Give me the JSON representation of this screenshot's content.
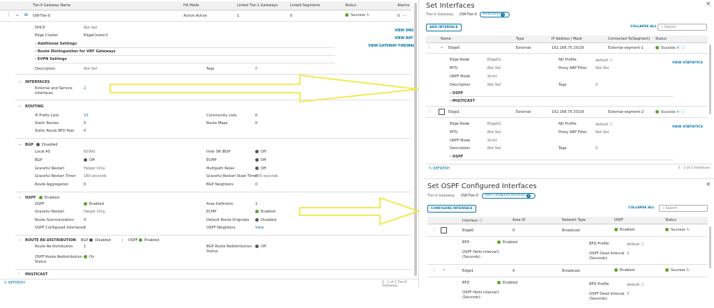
{
  "left": {
    "columns": [
      "Tier-0 Gateway Name",
      "HA Mode",
      "Linked Tier-1 Gateways",
      "Linked Segments",
      "Status",
      "Alarms"
    ],
    "row": {
      "name": "OW-Tier-0",
      "ha_mode": "Active Active",
      "tier1": "1",
      "segments": "0",
      "status": "Success",
      "alarms": "0"
    },
    "dhcp_label": "DHCP",
    "dhcp_value": "Not Set",
    "edge_cluster_label": "Edge Cluster",
    "edge_cluster_value": "EdgeCluster1",
    "additional_settings": "Additional Settings",
    "route_distinguisher": "Route Distinguisher for VRF Gateways",
    "evpn_settings": "EVPN Settings",
    "description_label": "Description",
    "description_value": "Not Set",
    "tags_label": "Tags",
    "tags_value": "0",
    "view_dns": "VIEW DNS",
    "view_nat": "VIEW NAT",
    "view_fw": "VIEW GATEWAY FIREWALL",
    "interfaces_title": "INTERFACES",
    "ext_service_label_1": "External and Service",
    "ext_service_label_2": "Interfaces",
    "ext_service_value": "2",
    "routing_title": "ROUTING",
    "ip_prefix_label": "IP Prefix Lists",
    "ip_prefix_value": "10",
    "community_label": "Community Lists",
    "community_value": "0",
    "static_routes_label": "Static Routes",
    "static_routes_value": "0",
    "route_maps_label": "Route Maps",
    "route_maps_value": "0",
    "static_bfd_label": "Static Route BFD Peer",
    "static_bfd_value": "0",
    "bgp_title": "BGP",
    "bgp_state": "Disabled",
    "local_as_label": "Local AS",
    "local_as_value": "65000",
    "inter_sr_label": "Inter SR iBGP",
    "inter_sr_value": "Off",
    "bgp_label": "BGP",
    "bgp_value": "Off",
    "ecmp_label": "ECMP",
    "ecmp_value": "Off",
    "gr_label": "Graceful Restart",
    "gr_value": "Helper Only",
    "multipath_label": "Multipath Relax",
    "multipath_value": "Off",
    "gr_timer_label": "Graceful Restart Timer",
    "gr_timer_value": "180 seconds",
    "gr_stale_label": "Graceful Restart Stale Timer",
    "gr_stale_value": "600 seconds",
    "route_agg_label": "Route Aggregation",
    "route_agg_value": "0",
    "bgp_neighbors_label": "BGP Neighbors",
    "bgp_neighbors_value": "0",
    "ospf_title": "OSPF",
    "ospf_state": "Enabled",
    "ospf_label": "OSPF",
    "ospf_value": "Enabled",
    "area_def_label": "Area Definition",
    "area_def_value": "1",
    "ospf_gr_label": "Graceful Restart",
    "ospf_gr_value": "Helper Only",
    "ospf_ecmp_label": "ECMP",
    "ospf_ecmp_value": "Enabled",
    "route_summ_label": "Route Summarization",
    "route_summ_value": "0",
    "default_route_label": "Default Route Originate",
    "default_route_value": "Disabled",
    "ospf_ci_label": "OSPF Configured Interfaces",
    "ospf_ci_value": "2",
    "ospf_neighbors_label": "OSPF Neighbors",
    "ospf_neighbors_value": "View",
    "redist_title": "ROUTE RE-DISTRIBUTION",
    "redist_bgp": "BGP",
    "redist_bgp_state": "Disabled",
    "redist_ospf": "OSPF",
    "redist_ospf_state": "Enabled",
    "route_redist_label": "Route Re-distribution",
    "route_redist_value": "1",
    "bgp_redist_status_label_1": "BGP Route Redistribution",
    "bgp_redist_status_label_2": "Status",
    "bgp_redist_status_value": "Off",
    "ospf_redist_status_label_1": "OSPF Route Redistribution",
    "ospf_redist_status_label_2": "Status",
    "ospf_redist_status_value": "On",
    "multicast_title": "MULTICAST",
    "refresh": "REFRESH",
    "footer": "1 - 1 of 1 Tier-0 Gateways"
  },
  "set_interfaces": {
    "title": "Set Interfaces",
    "gw_label": "Tier-0 Gateway",
    "gw_name": "OW-Tier-0",
    "badge": "#Interfaces",
    "badge_count": "2",
    "add_button": "ADD INTERFACE",
    "collapse": "COLLAPSE ALL",
    "search": "Search",
    "columns": [
      "Name",
      "Type",
      "IP Address / Mask",
      "Connected To(Segment)",
      "Status"
    ],
    "rows": [
      {
        "name": "Edge0",
        "type": "External",
        "ip": "192.168.75.20/29",
        "segment": "External-segment-1",
        "status": "Success",
        "edge_node": "Edge01",
        "nd_profile": "default",
        "mtu": "Not Set",
        "proxy_arp": "Not Set",
        "urpf": "Strict",
        "desc": "Not Set",
        "tags": "0"
      },
      {
        "name": "Edge1",
        "type": "External",
        "ip": "192.168.75.33/29",
        "segment": "External-segment-2",
        "status": "Success",
        "edge_node": "Edge02",
        "nd_profile": "default",
        "mtu": "Not Set",
        "proxy_arp": "Not Set",
        "urpf": "Strict",
        "desc": "Not Set",
        "tags": "0"
      }
    ],
    "lbl": {
      "edge_node": "Edge Node",
      "nd_profile": "ND Profile",
      "mtu": "MTU",
      "proxy_arp": "Proxy ARP Filter",
      "urpf": "URPF Mode",
      "desc": "Description",
      "tags": "Tags",
      "ospf": "OSPF",
      "multicast": "MULTICAST",
      "view_stats": "VIEW STATISTICS"
    },
    "refresh": "REFRESH",
    "footer": "1 - 2 of 2 Interfaces"
  },
  "set_ospf": {
    "title": "Set OSPF Configured Interfaces",
    "gw_label": "Tier-0 Gateway",
    "gw_name": "OW-Tier-0",
    "badge": "OSPF Configured Interfaces",
    "badge_count": "2",
    "configure_button": "CONFIGURE INTERFACE",
    "collapse": "COLLAPSE ALL",
    "search": "Search",
    "columns": [
      "Interface",
      "Area ID",
      "Network Type",
      "OSPF",
      "Status"
    ],
    "rows": [
      {
        "name": "Edge0",
        "area": "0",
        "net": "Broadcast",
        "ospf": "Enabled",
        "status": "Success",
        "bfd": "Enabled",
        "bfd_profile": "default",
        "hello": "1",
        "dead": "3"
      },
      {
        "name": "Edge1",
        "area": "0",
        "net": "Broadcast",
        "ospf": "Enabled",
        "status": "Success",
        "bfd": "Enabled",
        "bfd_profile": "default",
        "hello": "1",
        "dead": "3"
      }
    ],
    "lbl": {
      "bfd": "BFD",
      "bfd_profile": "BFD Profile",
      "hello_1": "OSPF Hello Interval",
      "hello_2": "(Seconds)",
      "dead_1": "OSPF Dead Interval",
      "dead_2": "(Seconds)"
    }
  },
  "colors": {
    "accent": "#0072a3",
    "success": "#5aa220",
    "arrow": "#f1e83b"
  }
}
